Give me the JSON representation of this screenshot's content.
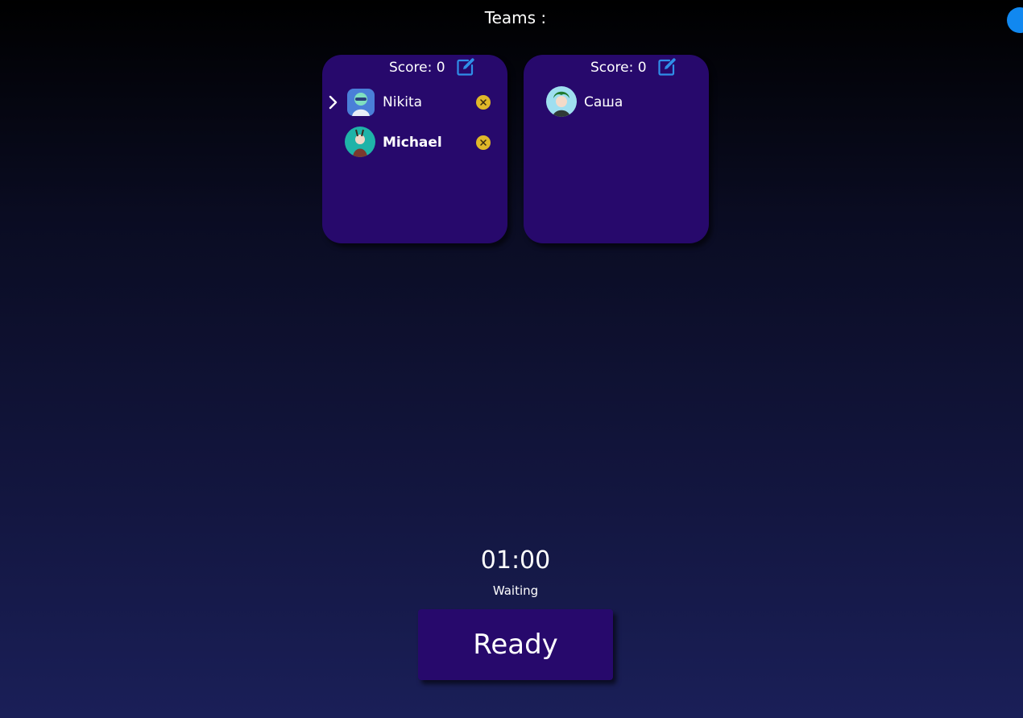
{
  "header": {
    "title": "Teams :"
  },
  "teams": [
    {
      "score_label": "Score: 0",
      "players": [
        {
          "name": "Nikita",
          "avatar": "avatar-nikita",
          "current": true,
          "bold": false
        },
        {
          "name": "Michael",
          "avatar": "avatar-michael",
          "current": false,
          "bold": true
        }
      ]
    },
    {
      "score_label": "Score: 0",
      "players": [
        {
          "name": "Саша",
          "avatar": "avatar-sasha",
          "current": false,
          "bold": false
        }
      ]
    }
  ],
  "timer": {
    "value": "01:00",
    "status": "Waiting"
  },
  "actions": {
    "ready_label": "Ready"
  },
  "icons": {
    "edit": "edit-icon",
    "remove": "close-icon",
    "current_player": "chevron-right-icon"
  },
  "colors": {
    "card_bg": "#27096c",
    "accent_blue": "#1188f0",
    "edit_icon": "#2f8fe8",
    "remove_badge": "#e0b829"
  }
}
